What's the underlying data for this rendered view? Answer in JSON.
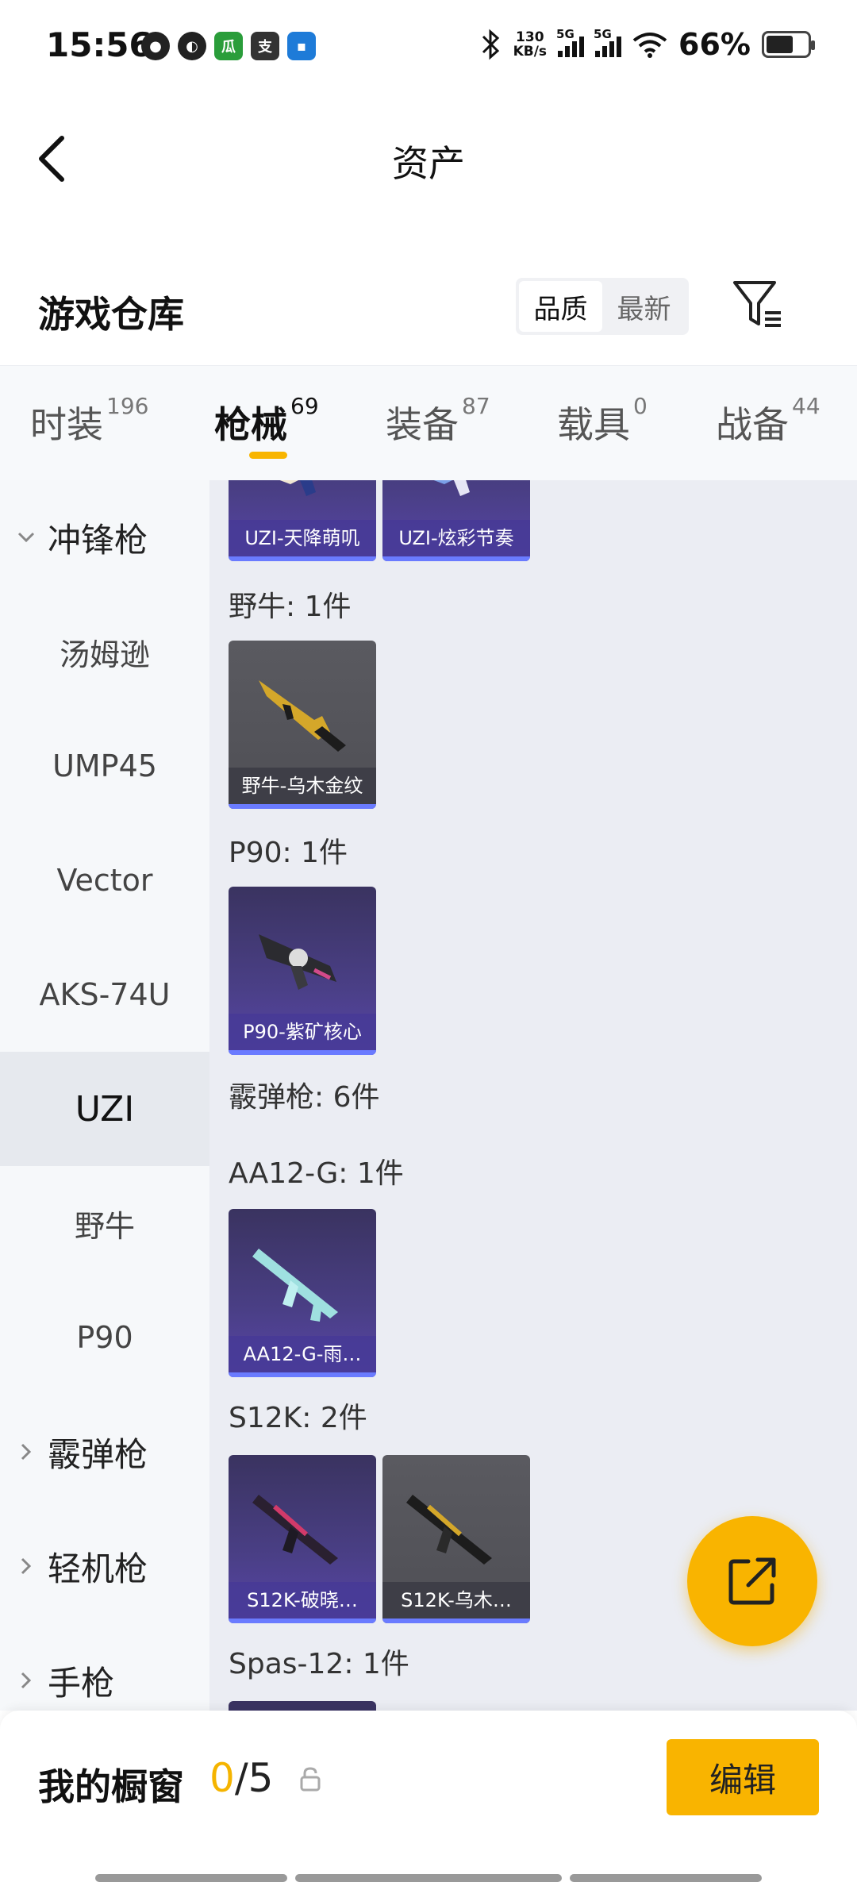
{
  "status_bar": {
    "time": "15:56",
    "speed_top": "130",
    "speed_unit": "KB/s",
    "net1": "5G",
    "net2": "5G",
    "battery_text": "66%",
    "battery_level": 0.66
  },
  "header": {
    "title": "资产",
    "back_icon": "chevron-left-icon"
  },
  "warehouse": {
    "title": "游戏仓库",
    "sort_options": [
      "品质",
      "最新"
    ],
    "sort_selected": "品质",
    "filter_icon": "filter-icon"
  },
  "tabs": [
    {
      "label": "时装",
      "count": "196"
    },
    {
      "label": "枪械",
      "count": "69"
    },
    {
      "label": "装备",
      "count": "87"
    },
    {
      "label": "载具",
      "count": "0"
    },
    {
      "label": "战备",
      "count": "44"
    }
  ],
  "sidebar": {
    "items": [
      {
        "label": "冲锋枪",
        "type": "category",
        "expanded": true
      },
      {
        "label": "汤姆逊",
        "type": "sub"
      },
      {
        "label": "UMP45",
        "type": "sub"
      },
      {
        "label": "Vector",
        "type": "sub"
      },
      {
        "label": "AKS-74U",
        "type": "sub"
      },
      {
        "label": "UZI",
        "type": "sub",
        "selected": true
      },
      {
        "label": "野牛",
        "type": "sub"
      },
      {
        "label": "P90",
        "type": "sub"
      },
      {
        "label": "霰弹枪",
        "type": "category",
        "expanded": false
      },
      {
        "label": "轻机枪",
        "type": "category",
        "expanded": false
      },
      {
        "label": "手枪",
        "type": "category",
        "expanded": false
      }
    ]
  },
  "content": {
    "uzi_cards": [
      "UZI-天降萌叽",
      "UZI-炫彩节奏"
    ],
    "groups": [
      {
        "label": "野牛: 1件",
        "cards": [
          "野牛-乌木金纹"
        ]
      },
      {
        "label": "P90: 1件",
        "cards": [
          "P90-紫矿核心"
        ]
      },
      {
        "label": "霰弹枪: 6件",
        "cards": []
      },
      {
        "label": "AA12-G: 1件",
        "cards": [
          "AA12-G-雨…"
        ]
      },
      {
        "label": "S12K: 2件",
        "cards": [
          "S12K-破晓…",
          "S12K-乌木…"
        ]
      },
      {
        "label": "Spas-12: 1件",
        "cards": []
      }
    ]
  },
  "fab": {
    "icon": "share-external-icon"
  },
  "showcase": {
    "label": "我的橱窗",
    "used": "0",
    "total": "/5",
    "lock_icon": "lock-icon",
    "edit_label": "编辑"
  },
  "colors": {
    "accent": "#f9b400",
    "purple_card": "#4a3f86",
    "sidebar_bg": "#f6f8fa",
    "content_bg": "#ebedf3"
  }
}
